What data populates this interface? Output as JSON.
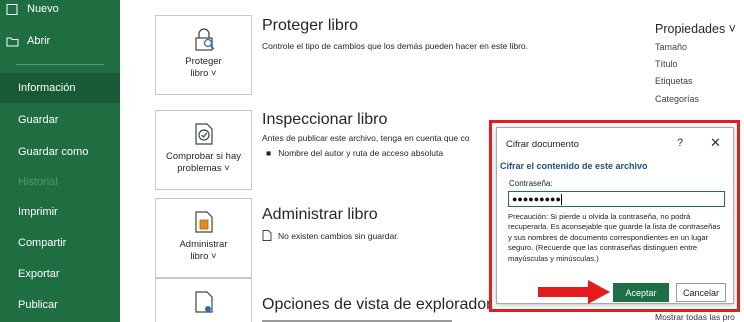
{
  "sidebar": {
    "items": [
      {
        "label": "Nuevo"
      },
      {
        "label": "Abrir"
      },
      {
        "label": "Información"
      },
      {
        "label": "Guardar"
      },
      {
        "label": "Guardar como"
      },
      {
        "label": "Historial"
      },
      {
        "label": "Imprimir"
      },
      {
        "label": "Compartir"
      },
      {
        "label": "Exportar"
      },
      {
        "label": "Publicar"
      }
    ]
  },
  "sections": {
    "protect": {
      "button_line1": "Proteger",
      "button_line2": "libro ˅",
      "title": "Proteger libro",
      "desc": "Controle el tipo de cambios que los demás pueden hacer en este libro."
    },
    "inspect": {
      "button_line1": "Comprobar si hay",
      "button_line2": "problemas ˅",
      "title": "Inspeccionar libro",
      "desc": "Antes de publicar este archivo, tenga en cuenta que co",
      "bullet": "Nombre del autor y ruta de acceso absoluta"
    },
    "manage": {
      "button_line1": "Administrar",
      "button_line2": "libro ˅",
      "title": "Administrar libro",
      "desc": "No existen cambios sin guardar."
    },
    "browser": {
      "title": "Opciones de vista de explorador"
    }
  },
  "properties": {
    "heading": "Propiedades ˅",
    "items": [
      "Tamaño",
      "Título",
      "Etiquetas",
      "Categorías"
    ],
    "bottom_partial": "Mostrar todas las pro"
  },
  "dialog": {
    "title": "Cifrar documento",
    "help": "?",
    "close": "✕",
    "heading": "Cifrar el contenido de este archivo",
    "password_label": "Contraseña:",
    "password_value": "●●●●●●●●●",
    "warning": "Precaución: Si pierde u olvida la contraseña, no podrá recuperarla. Es aconsejable que guarde la lista de contraseñas y sus nombres de documento correspondientes en un lugar seguro. (Recuerde que las contraseñas distinguen entre mayúsculas y minúsculas.)",
    "ok_label": "Aceptar",
    "cancel_label": "Cancelar"
  },
  "colors": {
    "sidebar_bg": "#1e6e42",
    "active_bg": "#185a35",
    "accent_button": "#1d7046",
    "highlight": "#e41c1c"
  }
}
